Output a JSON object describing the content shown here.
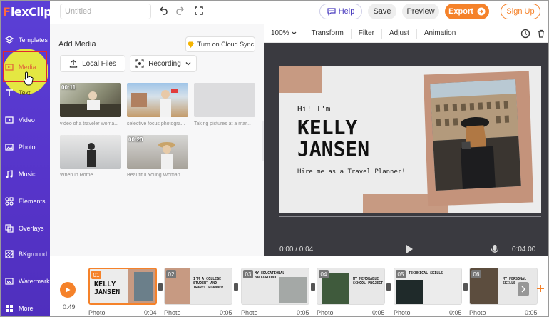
{
  "app": {
    "brand_mark": "F",
    "brand_text": "lexClip"
  },
  "sidebar": {
    "items": [
      {
        "label": "Templates",
        "icon": "templates-icon"
      },
      {
        "label": "Media",
        "icon": "media-icon"
      },
      {
        "label": "Text",
        "icon": "text-icon"
      },
      {
        "label": "Video",
        "icon": "video-icon"
      },
      {
        "label": "Photo",
        "icon": "photo-icon"
      },
      {
        "label": "Music",
        "icon": "music-icon"
      },
      {
        "label": "Elements",
        "icon": "elements-icon"
      },
      {
        "label": "Overlays",
        "icon": "overlays-icon"
      },
      {
        "label": "BKground",
        "icon": "background-icon"
      },
      {
        "label": "Watermark",
        "icon": "watermark-icon"
      },
      {
        "label": "More",
        "icon": "more-icon"
      }
    ]
  },
  "topbar": {
    "title_placeholder": "Untitled",
    "help": "Help",
    "save": "Save",
    "preview": "Preview",
    "export": "Export",
    "signup": "Sign Up"
  },
  "media_panel": {
    "title": "Add Media",
    "cloud_sync": "Turn on Cloud Sync",
    "local_files": "Local Files",
    "recording": "Recording",
    "items": [
      {
        "caption": "video of a traveler woma...",
        "duration": "00:11"
      },
      {
        "caption": "selective focus photogra...",
        "duration": ""
      },
      {
        "caption": "Taking pictures at a mar...",
        "duration": ""
      },
      {
        "caption": "When in Rome",
        "duration": ""
      },
      {
        "caption": "Beautiful Young Woman ...",
        "duration": "00:20"
      }
    ]
  },
  "editor": {
    "toolbar": {
      "zoom": "100%",
      "transform": "Transform",
      "filter": "Filter",
      "adjust": "Adjust",
      "animation": "Animation"
    },
    "slide": {
      "greeting": "Hi! I'm",
      "name_line1": "KELLY",
      "name_line2": "JANSEN",
      "subtitle": "Hire me as a Travel Planner!"
    },
    "playback": {
      "current": "0:00 / 0:04",
      "end": "0:04.00"
    }
  },
  "timeline": {
    "total": "0:49",
    "clips": [
      {
        "num": "01",
        "label": "Photo",
        "dur": "0:04",
        "text": "KELLY JANSEN"
      },
      {
        "num": "02",
        "label": "Photo",
        "dur": "0:05",
        "text": "I'M A COLLEGE STUDENT AND TRAVEL PLANNER"
      },
      {
        "num": "03",
        "label": "Photo",
        "dur": "0:05",
        "text": "MY EDUCATIONAL BACKGROUND"
      },
      {
        "num": "04",
        "label": "Photo",
        "dur": "0:05",
        "text": "MY MEMORABLE SCHOOL PROJECT"
      },
      {
        "num": "05",
        "label": "Photo",
        "dur": "0:05",
        "text": "TECHNICAL SKILLS"
      },
      {
        "num": "06",
        "label": "Photo",
        "dur": "0:05",
        "text": "MY PERSONAL SKILLS"
      }
    ]
  },
  "colors": {
    "sidebar": "#5634c9",
    "accent": "#f5822a",
    "highlight": "#ecf03a",
    "annotation": "#e3262f"
  }
}
